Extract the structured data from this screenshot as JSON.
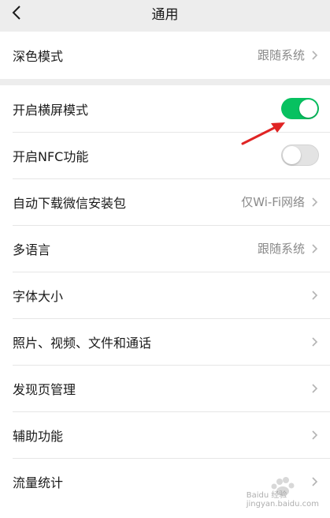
{
  "header": {
    "title": "通用"
  },
  "rows_group1": [
    {
      "id": "dark-mode",
      "label": "深色模式",
      "value": "跟随系统",
      "control": "chevron"
    }
  ],
  "rows_group2": [
    {
      "id": "landscape",
      "label": "开启横屏模式",
      "control": "toggle",
      "state": "on"
    },
    {
      "id": "nfc",
      "label": "开启NFC功能",
      "control": "toggle",
      "state": "off"
    },
    {
      "id": "auto-download",
      "label": "自动下载微信安装包",
      "value": "仅Wi-Fi网络",
      "control": "chevron"
    },
    {
      "id": "language",
      "label": "多语言",
      "value": "跟随系统",
      "control": "chevron"
    },
    {
      "id": "font-size",
      "label": "字体大小",
      "control": "chevron"
    },
    {
      "id": "media",
      "label": "照片、视频、文件和通话",
      "control": "chevron"
    },
    {
      "id": "discover",
      "label": "发现页管理",
      "control": "chevron"
    },
    {
      "id": "assist",
      "label": "辅助功能",
      "control": "chevron"
    },
    {
      "id": "traffic",
      "label": "流量统计",
      "control": "chevron"
    }
  ],
  "watermark": {
    "text": "Baidu 经验",
    "url": "jingyan.baidu.com"
  },
  "colors": {
    "toggle_on": "#07c160",
    "background": "#ededed",
    "annotation": "#e02424"
  }
}
